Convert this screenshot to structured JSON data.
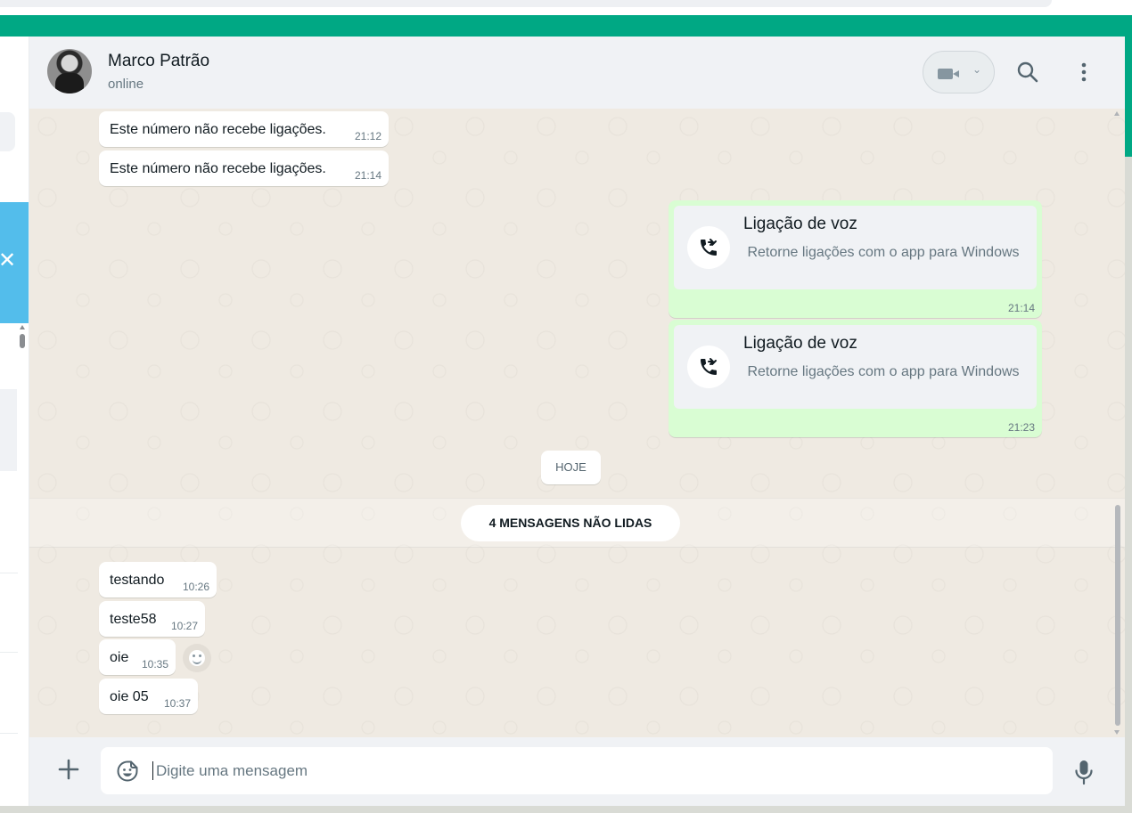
{
  "contact": {
    "name": "Marco Patrão",
    "status": "online"
  },
  "messages_before": [
    {
      "text": "Este número não recebe ligações.",
      "time": "21:12"
    },
    {
      "text": "Este número não recebe ligações.",
      "time": "21:14"
    }
  ],
  "calls": [
    {
      "title": "Ligação de voz",
      "subtitle": "Retorne ligações com o app para Windows",
      "time": "21:14"
    },
    {
      "title": "Ligação de voz",
      "subtitle": "Retorne ligações com o app para Windows",
      "time": "21:23"
    }
  ],
  "date_chip": "HOJE",
  "unread_label": "4 MENSAGENS NÃO LIDAS",
  "messages_after": [
    {
      "text": "testando",
      "time": "10:26"
    },
    {
      "text": "teste58",
      "time": "10:27"
    },
    {
      "text": "oie",
      "time": "10:35"
    },
    {
      "text": "oie 05",
      "time": "10:37"
    }
  ],
  "composer": {
    "placeholder": "Digite uma mensagem"
  },
  "icons": {
    "header": [
      "video-call-icon",
      "chevron-down-icon",
      "search-icon",
      "menu-icon"
    ],
    "composer": [
      "plus-icon",
      "sticker-icon",
      "mic-icon"
    ],
    "call": "incoming-call-icon",
    "reaction": "emoji-reaction-icon",
    "sidebar": "close-icon"
  },
  "colors": {
    "accent": "#00a884",
    "outgoing_bubble": "#d9fdd3",
    "incoming_bubble": "#ffffff",
    "chat_background": "#efeae2",
    "header_background": "#f0f2f5",
    "info_panel": "#53bdeb"
  }
}
